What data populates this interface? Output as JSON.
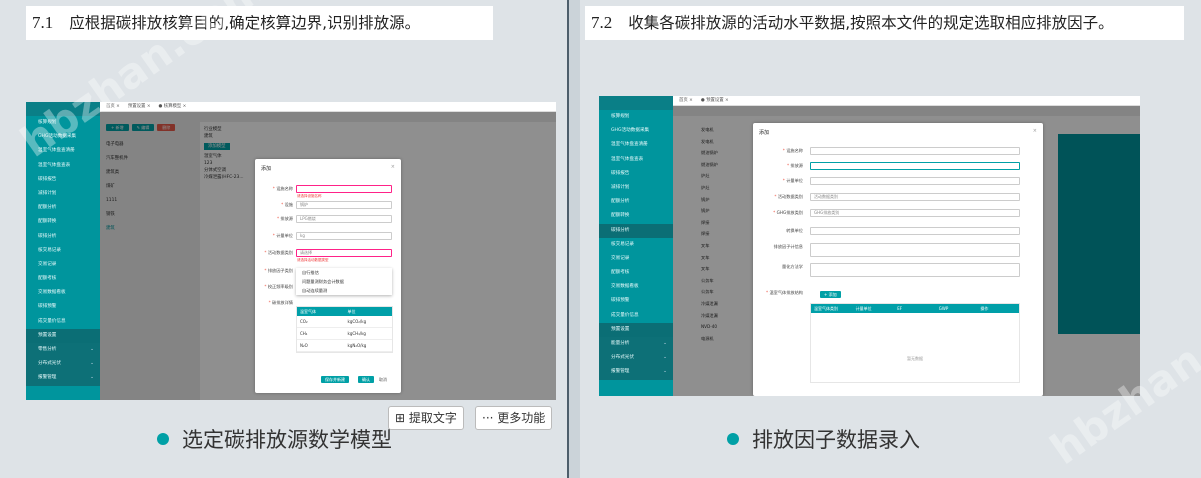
{
  "left": {
    "header_num": "7.1",
    "header_text": "应根据碳排放核算目的,确定核算边界,识别排放源。",
    "caption": "选定碳排放源数学模型",
    "sidebar": [
      "核算规划",
      "GHG活动数据采集",
      "温室气体盘查清册",
      "温室气体盘查表",
      "碳排报告",
      "减排计划",
      "配额分析",
      "配额转换",
      "碳排分析",
      "核交易记录",
      "交易记录",
      "配额考核",
      "交易数据看板",
      "碳排预警",
      "成交量价信息",
      "预置设置"
    ],
    "sidebar_groups": [
      "零售分析",
      "分布式光伏",
      "报警管理"
    ],
    "topbar": [
      "首页 ×",
      "预置设置 ×",
      "● 核算模型 ×"
    ],
    "buttons": [
      "+ 新增",
      "✎ 编辑",
      "删除"
    ],
    "tree": [
      "电子电器",
      "汽车整机件",
      "建筑类",
      "煤矿",
      "1111",
      "钢铁",
      "建筑"
    ],
    "mid_lines": [
      "行业模型",
      "建筑",
      "添加模型",
      "温室气体",
      "123",
      "分体式空调",
      "冷媒泄露(HFC-23..."
    ],
    "modal": {
      "title": "添加",
      "close": "×",
      "fields": [
        {
          "label": "设施名称",
          "value": "",
          "err": "请选择设施名称"
        },
        {
          "label": "设施",
          "value": "锅炉"
        },
        {
          "label": "排放源",
          "value": "LPG燃烧"
        },
        {
          "label": "计量单位",
          "value": "kg"
        },
        {
          "label": "活动数据类别",
          "value": "请选择",
          "err": "请选择活动数据类型"
        },
        {
          "label": "排放因子类别",
          "value": ""
        },
        {
          "label": "校正频率级别",
          "value": ""
        },
        {
          "label": "碳排放详情",
          "value": ""
        }
      ],
      "dropdown": [
        "自行推估",
        "问题量测财务会计数据",
        "自动连续量测"
      ],
      "table_headers": [
        "温室气体",
        "单位"
      ],
      "table_rows": [
        [
          "CO₂",
          "kgCO₂/kg"
        ],
        [
          "CH₄",
          "kgCH₄/kg"
        ],
        [
          "N₂O",
          "kgN₂O/kg"
        ]
      ],
      "buttons": [
        "保存并新建",
        "确认",
        "取消"
      ]
    },
    "tools": [
      "提取文字",
      "更多功能"
    ]
  },
  "right": {
    "header_num": "7.2",
    "header_text": "收集各碳排放源的活动水平数据,按照本文件的规定选取相应排放因子。",
    "caption": "排放因子数据录入",
    "sidebar": [
      "核算规划",
      "GHG活动数据采集",
      "温室气体盘查清册",
      "温室气体盘查表",
      "碳排报告",
      "减排计划",
      "配额分析",
      "配额转换",
      "碳排分析",
      "核交易记录",
      "交易记录",
      "配额考核",
      "交易数据看板",
      "碳排预警",
      "成交量价信息",
      "预置设置"
    ],
    "sidebar_groups": [
      "能量分析",
      "分布式光伏",
      "报警管理"
    ],
    "topbar": [
      "首页 ×",
      "● 预置设置 ×"
    ],
    "bg_rows": [
      "发电机",
      "发电机",
      "燃油锅炉",
      "燃油锅炉",
      "炉灶",
      "炉灶",
      "锅炉",
      "锅炉",
      "焊接",
      "焊接",
      "叉车",
      "叉车",
      "叉车",
      "公务车",
      "公务车",
      "冷媒泄漏",
      "冷媒泄漏",
      "NVD-40",
      "电源机"
    ],
    "modal": {
      "title": "添加",
      "close": "×",
      "fields": [
        {
          "label": "设施名称",
          "value": ""
        },
        {
          "label": "排放源",
          "value": ""
        },
        {
          "label": "计量单位",
          "value": ""
        },
        {
          "label": "活动数据类别",
          "value": "活动数据类别"
        },
        {
          "label": "GHG排放类别",
          "value": "GHG排放类别"
        },
        {
          "label": "转换单位",
          "value": ""
        },
        {
          "label": "排放因子计信息",
          "value": ""
        },
        {
          "label": "量化方法学",
          "value": ""
        },
        {
          "label": "温室气体排放结构",
          "value": ""
        }
      ],
      "add_btn": "+ 添加",
      "table_headers": [
        "温室气体类别",
        "计量单位",
        "EF",
        "GWP",
        "操作"
      ],
      "empty": "暂无数据"
    }
  },
  "colors": {
    "teal": "#00959d",
    "teal_dark": "#0b6e75",
    "accent": "#00a0a6"
  }
}
